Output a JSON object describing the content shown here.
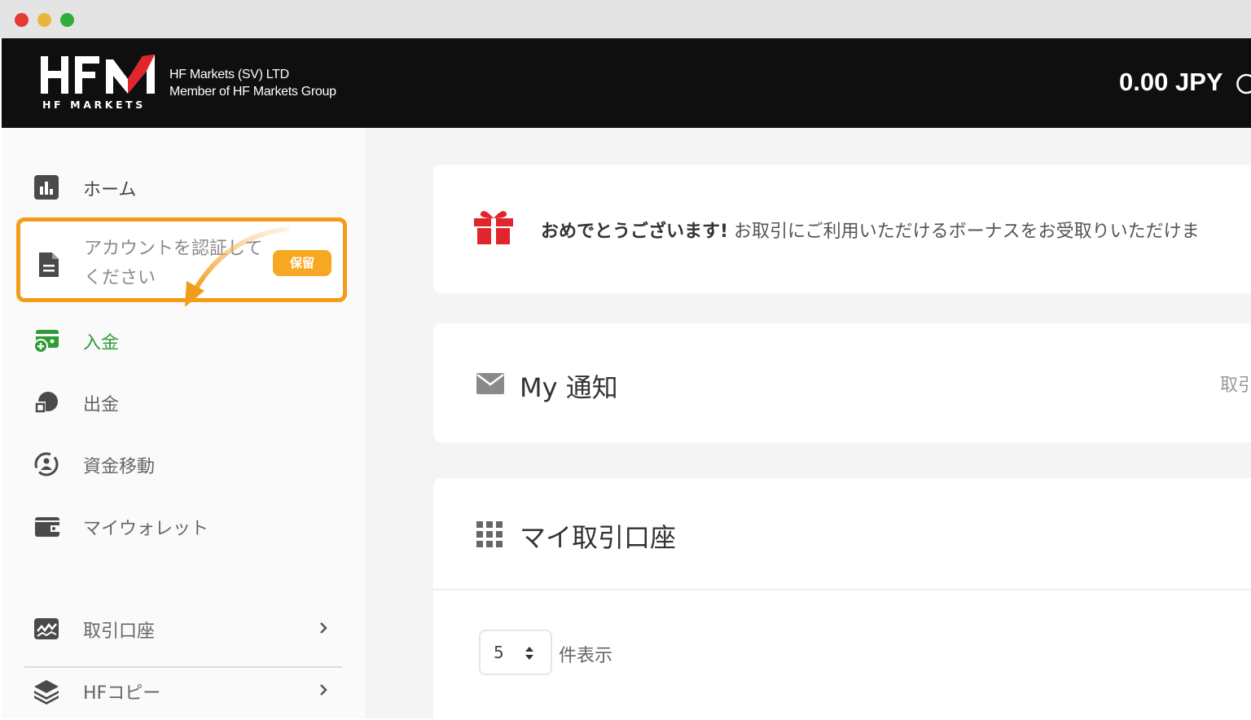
{
  "header": {
    "logo_sub": "HF MARKETS",
    "company_line1": "HF Markets (SV) LTD",
    "company_line2": "Member of HF Markets Group",
    "balance": "0.00 JPY"
  },
  "sidebar": {
    "items": [
      {
        "label": "ホーム",
        "icon": "chart-bar-icon"
      },
      {
        "label": "アカウントを認証してください",
        "badge": "保留",
        "icon": "document-icon"
      },
      {
        "label": "入金",
        "icon": "wallet-plus-icon"
      },
      {
        "label": "出金",
        "icon": "withdraw-icon"
      },
      {
        "label": "資金移動",
        "icon": "transfer-icon"
      },
      {
        "label": "マイウォレット",
        "icon": "wallet-icon"
      },
      {
        "label": "取引口座",
        "icon": "trading-chart-icon"
      },
      {
        "label": "HFコピー",
        "icon": "layers-icon"
      }
    ]
  },
  "main": {
    "bonus": {
      "bold": "おめでとうございます!",
      "text": " お取引にご利用いただけるボーナスをお受取りいただけま"
    },
    "notice": {
      "title": "My 通知",
      "link": "取引"
    },
    "accounts": {
      "title": "マイ取引口座",
      "page_size": "5",
      "page_size_label": "件表示"
    }
  },
  "colors": {
    "accent_orange": "#f39c1a",
    "deposit_green": "#2e9c36",
    "brand_red": "#e1252d",
    "header_bg": "#0f0f0f"
  }
}
